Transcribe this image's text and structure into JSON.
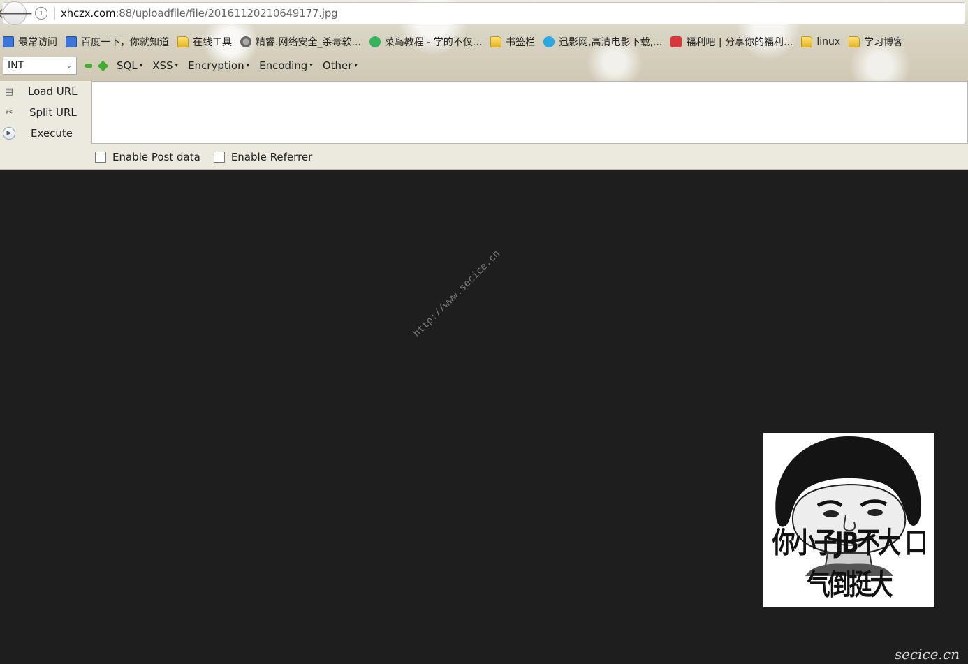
{
  "browser": {
    "url_host": "xhczx.com",
    "url_rest": ":88/uploadfile/file/20161120210649177.jpg",
    "info_glyph": "i",
    "back_glyph": "🡐"
  },
  "bookmarks": [
    {
      "label": "最常访问",
      "icon": "bookmark-page-icon"
    },
    {
      "label": "百度一下，你就知道",
      "icon": "baidu-paw-icon"
    },
    {
      "label": "在线工具",
      "icon": "folder-icon"
    },
    {
      "label": "精睿.网络安全_杀毒软...",
      "icon": "globe-icon"
    },
    {
      "label": "菜鸟教程 - 学的不仅...",
      "icon": "runoob-icon"
    },
    {
      "label": "书签栏",
      "icon": "folder-icon"
    },
    {
      "label": "迅影网,高清电影下载,...",
      "icon": "xunying-icon"
    },
    {
      "label": "福利吧 | 分享你的福利...",
      "icon": "fuliba-icon"
    },
    {
      "label": "linux",
      "icon": "folder-icon"
    },
    {
      "label": "学习博客",
      "icon": "folder-icon"
    }
  ],
  "hackbar": {
    "type_select": "INT",
    "menus": [
      "SQL",
      "XSS",
      "Encryption",
      "Encoding",
      "Other"
    ],
    "load_url": "Load URL",
    "split_url": "Split URL",
    "execute": "Execute",
    "url_value": "",
    "enable_post": "Enable Post data",
    "enable_referrer": "Enable Referrer"
  },
  "page": {
    "watermark": "http://www.secice.cn",
    "meme_caption": "你小子JB不大 口气倒挺大",
    "site_mark": "secice.cn"
  }
}
